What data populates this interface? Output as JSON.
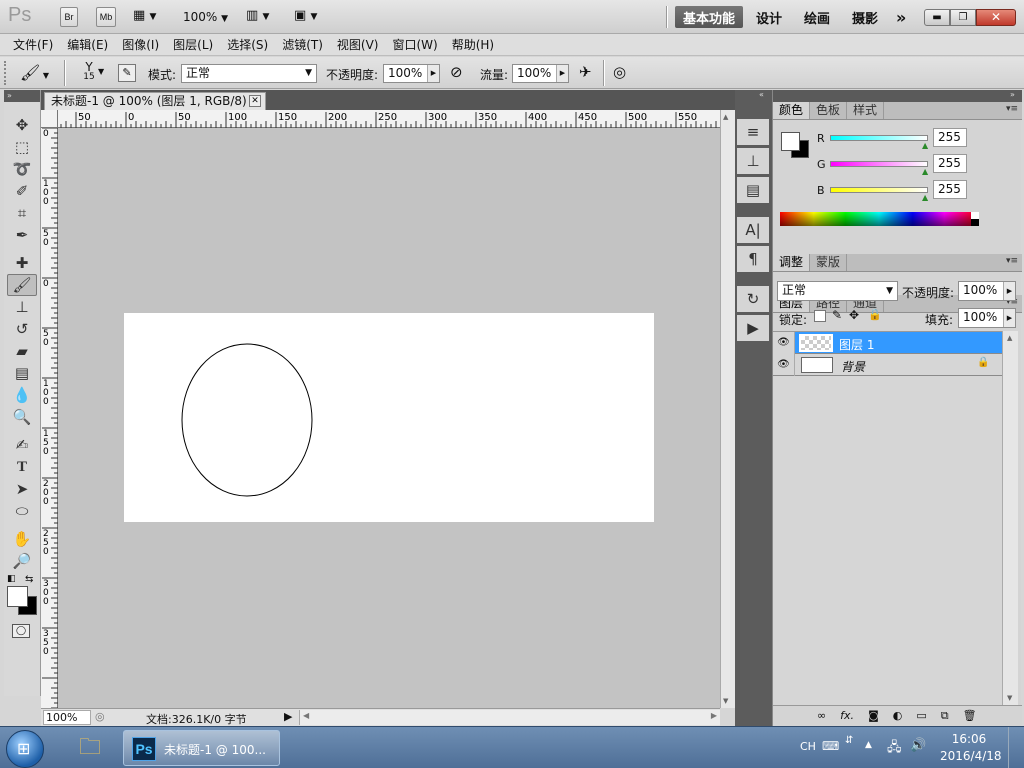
{
  "app": {
    "logo": "Ps",
    "bridge_label": "Br",
    "minibridge_label": "Mb",
    "zoom": "100%",
    "workspaces": [
      "基本功能",
      "设计",
      "绘画",
      "摄影"
    ],
    "more_label": "»"
  },
  "menu": [
    "文件(F)",
    "编辑(E)",
    "图像(I)",
    "图层(L)",
    "选择(S)",
    "滤镜(T)",
    "视图(V)",
    "窗口(W)",
    "帮助(H)"
  ],
  "options": {
    "brush_size": "15",
    "mode_label": "模式:",
    "mode_value": "正常",
    "opacity_label": "不透明度:",
    "opacity_value": "100%",
    "flow_label": "流量:",
    "flow_value": "100%"
  },
  "document": {
    "tab_title": "未标题-1 @ 100% (图层 1, RGB/8) *",
    "hruler_labels": [
      "50",
      "0",
      "50",
      "100",
      "150",
      "200",
      "250",
      "300",
      "350",
      "400",
      "450",
      "500",
      "550"
    ],
    "vruler_labels": [
      "0",
      "1\n0\n0",
      "5\n0",
      "0",
      "5\n0",
      "1\n0\n0",
      "1\n5\n0",
      "2\n0\n0",
      "2\n5\n0",
      "3\n0\n0",
      "3\n5\n0"
    ],
    "status_zoom": "100%",
    "status_doc": "文档:326.1K/0 字节"
  },
  "color_panel": {
    "tabs": [
      "颜色",
      "色板",
      "样式"
    ],
    "channels": [
      {
        "label": "R",
        "value": "255",
        "gradient": "linear-gradient(90deg,#00ffff,#ffffff)"
      },
      {
        "label": "G",
        "value": "255",
        "gradient": "linear-gradient(90deg,#ff00ff,#ffffff)"
      },
      {
        "label": "B",
        "value": "255",
        "gradient": "linear-gradient(90deg,#ffff00,#ffffff)"
      }
    ]
  },
  "adjust_panel": {
    "tabs": [
      "调整",
      "蒙版"
    ]
  },
  "layers_panel": {
    "tabs": [
      "图层",
      "路径",
      "通道"
    ],
    "blend_mode": "正常",
    "opacity_label": "不透明度:",
    "opacity_value": "100%",
    "lock_label": "锁定:",
    "fill_label": "填充:",
    "fill_value": "100%",
    "layers": [
      {
        "name": "图层 1",
        "selected": true
      },
      {
        "name": "背景",
        "selected": false
      }
    ]
  },
  "taskbar": {
    "task_label": "未标题-1 @ 100...",
    "lang": "CH",
    "time": "16:06",
    "date": "2016/4/18"
  },
  "colors": {
    "selection": "#3399ff",
    "canvas_bg": "#c3c3c3",
    "taskbar": "#5a7aa2"
  }
}
